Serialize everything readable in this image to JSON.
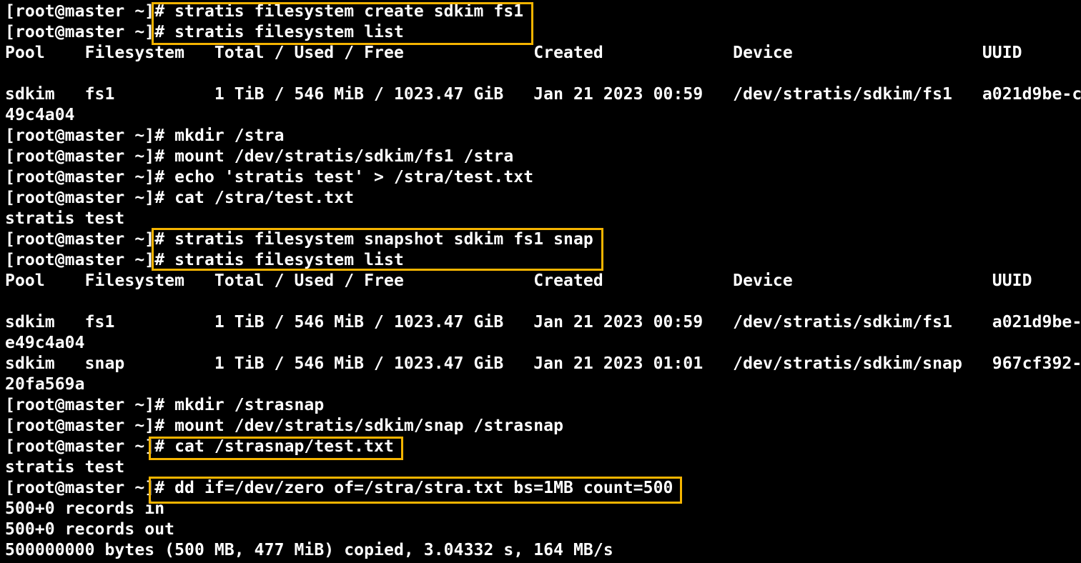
{
  "terminal": {
    "lines": [
      "[root@master ~]# stratis filesystem create sdkim fs1",
      "[root@master ~]# stratis filesystem list",
      "Pool    Filesystem   Total / Used / Free             Created             Device                   UUID",
      "",
      "sdkim   fs1          1 TiB / 546 MiB / 1023.47 GiB   Jan 21 2023 00:59   /dev/stratis/sdkim/fs1   a021d9be-c",
      "49c4a04",
      "[root@master ~]# mkdir /stra",
      "[root@master ~]# mount /dev/stratis/sdkim/fs1 /stra",
      "[root@master ~]# echo 'stratis test' > /stra/test.txt",
      "[root@master ~]# cat /stra/test.txt",
      "stratis test",
      "[root@master ~]# stratis filesystem snapshot sdkim fs1 snap",
      "[root@master ~]# stratis filesystem list",
      "Pool    Filesystem   Total / Used / Free             Created             Device                    UUID",
      "",
      "sdkim   fs1          1 TiB / 546 MiB / 1023.47 GiB   Jan 21 2023 00:59   /dev/stratis/sdkim/fs1    a021d9be-",
      "e49c4a04",
      "sdkim   snap         1 TiB / 546 MiB / 1023.47 GiB   Jan 21 2023 01:01   /dev/stratis/sdkim/snap   967cf392-",
      "20fa569a",
      "[root@master ~]# mkdir /strasnap",
      "[root@master ~]# mount /dev/stratis/sdkim/snap /strasnap",
      "[root@master ~]# cat /strasnap/test.txt",
      "stratis test",
      "[root@master ~]# dd if=/dev/zero of=/stra/stra.txt bs=1MB count=500",
      "500+0 records in",
      "500+0 records out",
      "500000000 bytes (500 MB, 477 MiB) copied, 3.04332 s, 164 MB/s"
    ]
  },
  "colors": {
    "background": "#000000",
    "text": "#ffffff",
    "highlight": "#f5b400"
  }
}
